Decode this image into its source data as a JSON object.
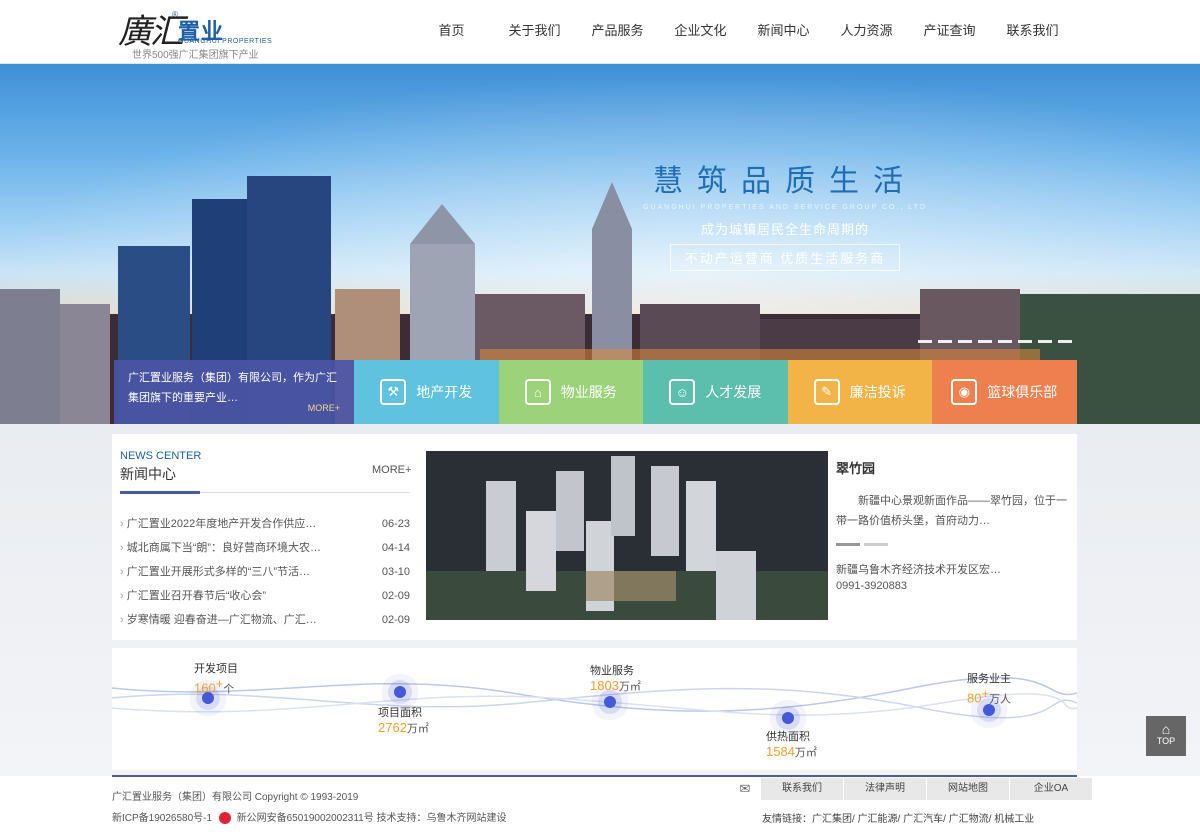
{
  "header": {
    "logo_mark": "廣汇",
    "logo_cn": "置业",
    "logo_en": "GUANGHUI PROPERTIES",
    "logo_reg": "®",
    "tagline": "世界500强广汇集团旗下产业",
    "nav": [
      "首页",
      "关于我们",
      "产品服务",
      "企业文化",
      "新闻中心",
      "人力资源",
      "产证查询",
      "联系我们"
    ]
  },
  "banner": {
    "title": "慧筑品质生活",
    "subtitle_en": "GUANGHUI PROPERTIES AND SERVICE GROUP CO., LTD",
    "line1": "成为城镇居民全生命周期的",
    "line2": "不动产运营商  优质生活服务商",
    "intro_text": "广汇置业服务（集团）有限公司，作为广汇集团旗下的重要产业…",
    "intro_more": "MORE+",
    "tiles": [
      {
        "label": "地产开发",
        "icon": "crane-icon",
        "color": "#5fc3e0",
        "glyph": "⚒"
      },
      {
        "label": "物业服务",
        "icon": "house-icon",
        "color": "#9bd27a",
        "glyph": "⌂"
      },
      {
        "label": "人才发展",
        "icon": "people-icon",
        "color": "#5cbfae",
        "glyph": "☺"
      },
      {
        "label": "廉洁投诉",
        "icon": "document-icon",
        "color": "#f2b447",
        "glyph": "✎"
      },
      {
        "label": "篮球俱乐部",
        "icon": "basketball-icon",
        "color": "#ee7f4f",
        "glyph": "◉"
      }
    ]
  },
  "news": {
    "title_en": "NEWS CENTER",
    "title_cn": "新闻中心",
    "more": "MORE+",
    "items": [
      {
        "title": "广汇置业2022年度地产开发合作供应…",
        "date": "06-23"
      },
      {
        "title": "城北商属下当“朗”：良好营商环境大农…",
        "date": "04-14"
      },
      {
        "title": "广汇置业开展形式多样的“三八”节活…",
        "date": "03-10"
      },
      {
        "title": "广汇置业召开春节后“收心会”",
        "date": "02-09"
      },
      {
        "title": "岁寒情暖 迎春奋进—广汇物流、广汇…",
        "date": "02-09"
      }
    ]
  },
  "project": {
    "name": "翠竹园",
    "desc": "新疆中心景观新面作品——翠竹园，位于一带一路价值桥头堡，首府动力…",
    "address": "新疆乌鲁木齐经济技术开发区宏…",
    "phone": "0991-3920883"
  },
  "stats": [
    {
      "label": "开发项目",
      "value": "160",
      "sup": "+",
      "unit": "个"
    },
    {
      "label": "项目面积",
      "value": "2762",
      "sup": "",
      "unit": "万㎡"
    },
    {
      "label": "物业服务",
      "value": "1803",
      "sup": "",
      "unit": "万㎡"
    },
    {
      "label": "供热面积",
      "value": "1584",
      "sup": "",
      "unit": "万㎡"
    },
    {
      "label": "服务业主",
      "value": "80",
      "sup": "+",
      "unit": "万人"
    }
  ],
  "footer": {
    "copyright": "广汇置业服务（集团）有限公司 Copyright © 1993-2019",
    "icp": "新ICP备19026580号-1",
    "police": "新公网安备65019002002311号 技术支持：乌鲁木齐网站建设",
    "links": [
      "联系我们",
      "法律声明",
      "网站地图",
      "企业OA"
    ],
    "friends": "友情链接：广汇集团/ 广汇能源/ 广汇汽车/ 广汇物流/ 机械工业"
  },
  "top_button": "TOP"
}
